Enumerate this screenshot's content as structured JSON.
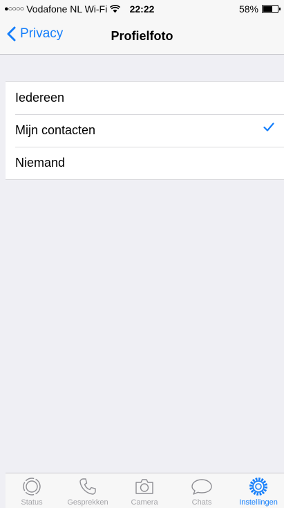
{
  "status_bar": {
    "signal": "●○○○○",
    "carrier": "Vodafone NL Wi-Fi",
    "time": "22:22",
    "battery": "58%",
    "battery_level": 0.58
  },
  "nav": {
    "back_label": "Privacy",
    "title": "Profielfoto"
  },
  "options": [
    {
      "label": "Iedereen",
      "selected": false
    },
    {
      "label": "Mijn contacten",
      "selected": true
    },
    {
      "label": "Niemand",
      "selected": false
    }
  ],
  "tab_bar": {
    "tabs": [
      {
        "label": "Status",
        "icon": "status-icon"
      },
      {
        "label": "Gesprekken",
        "icon": "phone-icon"
      },
      {
        "label": "Camera",
        "icon": "camera-icon"
      },
      {
        "label": "Chats",
        "icon": "chat-bubble-icon"
      },
      {
        "label": "Instellingen",
        "icon": "gear-icon"
      }
    ],
    "active": "Instellingen"
  },
  "colors": {
    "accent": "#147efb",
    "background": "#efeff4",
    "inactive": "#a5a5a9"
  }
}
